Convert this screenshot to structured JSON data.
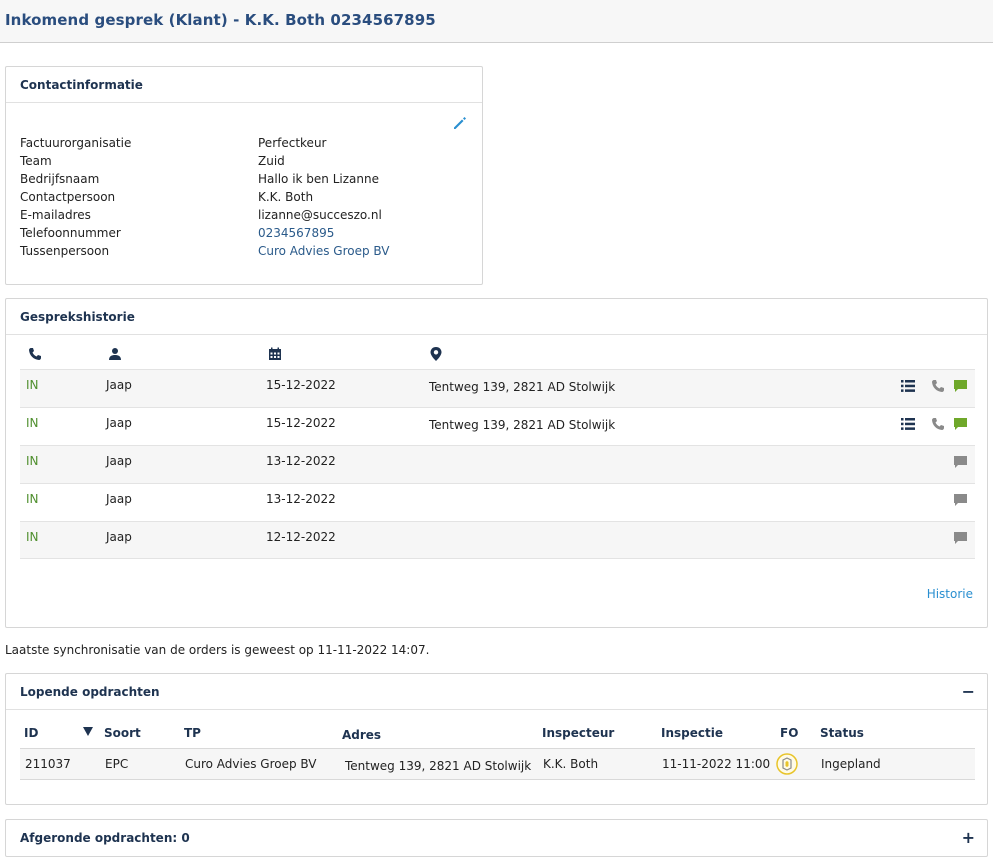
{
  "header": {
    "title": "Inkomend gesprek  (Klant)  -  K.K. Both  0234567895"
  },
  "contact": {
    "title": "Contactinformatie",
    "rows": [
      {
        "label": "Factuurorganisatie",
        "value": "Perfectkeur"
      },
      {
        "label": "Team",
        "value": "Zuid"
      },
      {
        "label": "Bedrijfsnaam",
        "value": "Hallo ik ben Lizanne"
      },
      {
        "label": "Contactpersoon",
        "value": "K.K. Both"
      },
      {
        "label": "E-mailadres",
        "value": "lizanne@succeszo.nl"
      },
      {
        "label": "Telefoonnummer",
        "value": "0234567895"
      },
      {
        "label": "Tussenpersoon",
        "value": "Curo Advies Groep BV"
      }
    ]
  },
  "history": {
    "title": "Gesprekshistorie",
    "columns_icons": [
      "phone-icon",
      "user-icon",
      "calendar-icon",
      "location-pin-icon"
    ],
    "rows": [
      {
        "direction": "IN",
        "person": "Jaap",
        "date": "15-12-2022",
        "address": "Tentweg 139, 2821 AD Stolwijk"
      },
      {
        "direction": "IN",
        "person": "Jaap",
        "date": "15-12-2022",
        "address": "Tentweg 139, 2821 AD Stolwijk"
      },
      {
        "direction": "IN",
        "person": "Jaap",
        "date": "13-12-2022",
        "address": ""
      },
      {
        "direction": "IN",
        "person": "Jaap",
        "date": "13-12-2022",
        "address": ""
      },
      {
        "direction": "IN",
        "person": "Jaap",
        "date": "12-12-2022",
        "address": ""
      }
    ],
    "link_label": "Historie"
  },
  "sync_text": "Laatste synchronisatie van de orders is geweest op 11-11-2022 14:07.",
  "orders": {
    "title": "Lopende opdrachten",
    "toggle": "−",
    "columns": [
      "ID",
      "Soort",
      "TP",
      "Adres",
      "Inspecteur",
      "Inspectie",
      "FO",
      "Status"
    ],
    "rows": [
      {
        "id": "211037",
        "soort": "EPC",
        "tp": "Curo Advies Groep BV",
        "adres": "Tentweg 139, 2821 AD Stolwijk",
        "inspecteur": "K.K. Both",
        "inspectie": "11-11-2022 11:00",
        "status": "Ingepland"
      }
    ]
  },
  "finished": {
    "title": "Afgeronde opdrachten: 0",
    "toggle": "+"
  },
  "colors": {
    "accent": "#2a4d7e",
    "in_green": "#4f8f2e",
    "chat_green": "#6fa82a",
    "link_blue": "#2a8fd0"
  }
}
